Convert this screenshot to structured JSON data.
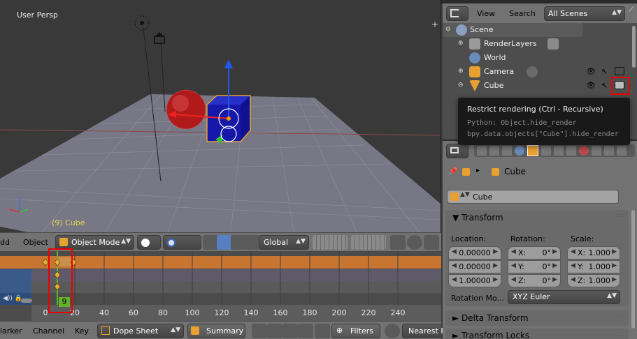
{
  "viewport": {
    "view_label": "User Persp",
    "active_object_label": "(9) Cube",
    "plus_glyph": "+"
  },
  "v3d_header": {
    "menu_add": "dd",
    "menu_object": "Object",
    "mode": "Object Mode",
    "orientation": "Global"
  },
  "dopesheet": {
    "current_frame": "9",
    "ruler": [
      "0",
      "20",
      "40",
      "60",
      "80",
      "100",
      "120",
      "140",
      "160",
      "180",
      "200",
      "220",
      "240"
    ]
  },
  "ds_header": {
    "menu_marker": "larker",
    "menu_channel": "Channel",
    "menu_key": "Key",
    "editor_mode": "Dope Sheet",
    "summary": "Summary",
    "filters": "Filters",
    "snap": "Nearest F"
  },
  "outliner": {
    "menu_view": "View",
    "menu_search": "Search",
    "display_mode": "All Scenes",
    "items": [
      {
        "label": "Scene"
      },
      {
        "label": "RenderLayers"
      },
      {
        "label": "World"
      },
      {
        "label": "Camera"
      },
      {
        "label": "Cube"
      }
    ]
  },
  "tooltip": {
    "title": "Restrict rendering (Ctrl - Recursive)",
    "python": "Python: Object.hide_render",
    "path": "bpy.data.objects[\"Cube\"].hide_render"
  },
  "properties": {
    "context_name": "Cube",
    "object_name": "Cube",
    "transform_title": "Transform",
    "col_location": "Location:",
    "col_rotation": "Rotation:",
    "col_scale": "Scale:",
    "location": [
      "0.00000",
      "0.00000",
      "1.00000"
    ],
    "rotation": [
      {
        "axis": "X:",
        "value": "0°"
      },
      {
        "axis": "Y:",
        "value": "0°"
      },
      {
        "axis": "Z:",
        "value": "0°"
      }
    ],
    "scale": [
      {
        "axis": "X:",
        "value": "1.000"
      },
      {
        "axis": "Y:",
        "value": "1.000"
      },
      {
        "axis": "Z:",
        "value": "1.000"
      }
    ],
    "rotation_mode_label": "Rotation Mo...",
    "rotation_mode_value": "XYZ Euler",
    "delta_title": "Delta Transform",
    "locks_title": "Transform Locks"
  },
  "colors": {
    "highlight_box": "#ee0000",
    "keyframe": "#e8b030",
    "frame_indicator": "#63b22b",
    "selected_object": "#e8a030"
  }
}
